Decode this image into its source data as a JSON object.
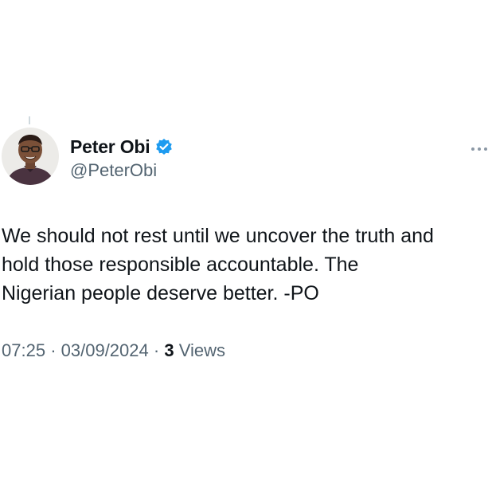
{
  "tweet": {
    "author": {
      "name": "Peter Obi",
      "handle": "@PeterObi",
      "verified": true
    },
    "text": "We should not rest until we uncover the truth and\nhold those responsible accountable. The\nNigerian people deserve better. -PO",
    "time": "07:25",
    "date": "03/09/2024",
    "separator": "·",
    "views_count": "3",
    "views_label": "Views"
  },
  "icons": {
    "verified_badge": "verified-badge-icon",
    "more": "more-options-icon"
  },
  "colors": {
    "background": "#ffffff",
    "text_primary": "#0f1419",
    "text_secondary": "#536471",
    "verified_blue": "#1d9bf0"
  }
}
